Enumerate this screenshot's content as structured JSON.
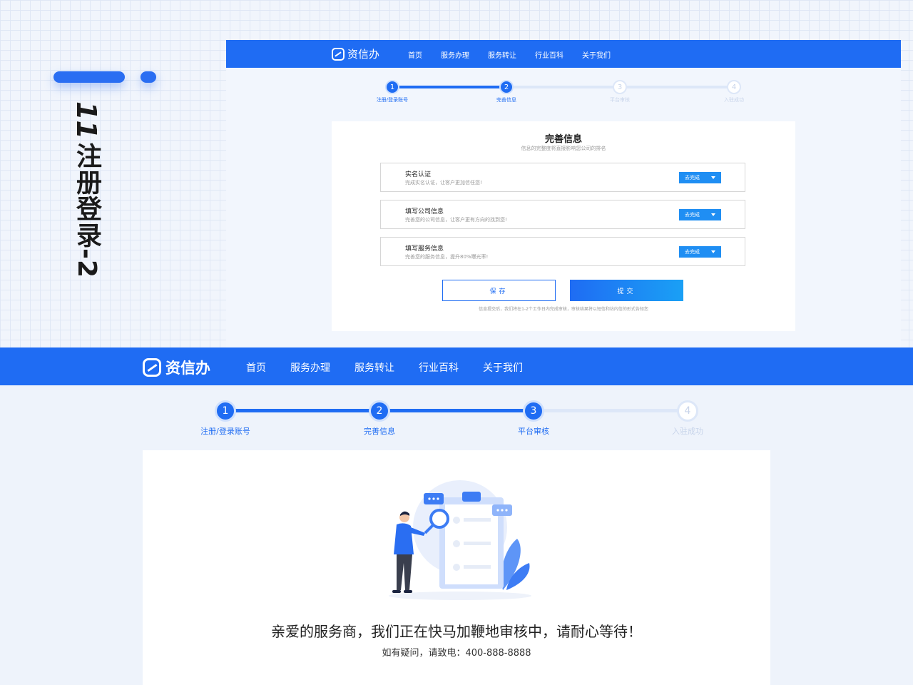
{
  "side_title": {
    "number": "11",
    "text": "注册登录-2"
  },
  "mini": {
    "logo": "资信办",
    "nav": [
      "首页",
      "服务办理",
      "服务转让",
      "行业百科",
      "关于我们"
    ],
    "steps": [
      {
        "num": "1",
        "label": "注册/登录账号",
        "state": "done"
      },
      {
        "num": "2",
        "label": "完善信息",
        "state": "active"
      },
      {
        "num": "3",
        "label": "平台审核",
        "state": "todo"
      },
      {
        "num": "4",
        "label": "入驻成功",
        "state": "todo"
      }
    ],
    "card_title": "完善信息",
    "card_subtitle": "信息的完整度将直接影响您公司的排名",
    "tasks": [
      {
        "title": "实名认证",
        "desc": "完成实名认证，让客户更加信任您!",
        "button": "去完成"
      },
      {
        "title": "填写公司信息",
        "desc": "完善您的公司信息，让客户更有方向的找到您!",
        "button": "去完成"
      },
      {
        "title": "填写服务信息",
        "desc": "完善您的服务信息，提升80%曝光率!",
        "button": "去完成"
      }
    ],
    "save_label": "保存",
    "submit_label": "提交",
    "note": "信息提交后，我们将在1-2个工作日内完成审核，审核结果将以短信和站内信的形式告知您"
  },
  "main": {
    "logo": "资信办",
    "nav": [
      "首页",
      "服务办理",
      "服务转让",
      "行业百科",
      "关于我们"
    ],
    "steps": [
      {
        "num": "1",
        "label": "注册/登录账号",
        "state": "done"
      },
      {
        "num": "2",
        "label": "完善信息",
        "state": "done"
      },
      {
        "num": "3",
        "label": "平台审核",
        "state": "active"
      },
      {
        "num": "4",
        "label": "入驻成功",
        "state": "todo"
      }
    ],
    "message": "亲爱的服务商，我们正在快马加鞭地审核中，请耐心等待！",
    "contact": "如有疑问，请致电：400-888-8888"
  },
  "colors": {
    "primary": "#1f6cf3",
    "light": "#dde7f8",
    "todo_text": "#c8d4ea"
  }
}
